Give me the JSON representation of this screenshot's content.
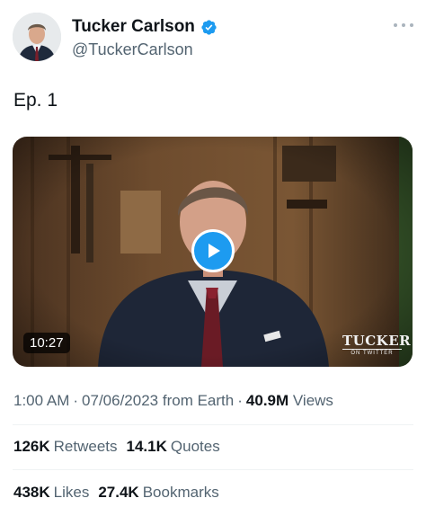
{
  "author": {
    "display_name": "Tucker Carlson",
    "handle": "@TuckerCarlson",
    "verified_icon": "verified-badge-icon",
    "verified_color": "#1d9bf0"
  },
  "tweet": {
    "text": "Ep. 1"
  },
  "video": {
    "duration": "10:27",
    "watermark_main": "TUCKER",
    "watermark_sub": "ON TWITTER",
    "play_icon": "play-icon",
    "accent": "#1d9bf0"
  },
  "meta": {
    "time": "1:00 AM",
    "date": "07/06/2023",
    "source": "from Earth",
    "views_count": "40.9M",
    "views_label": "Views",
    "separator": "·"
  },
  "stats": {
    "retweets_count": "126K",
    "retweets_label": "Retweets",
    "quotes_count": "14.1K",
    "quotes_label": "Quotes",
    "likes_count": "438K",
    "likes_label": "Likes",
    "bookmarks_count": "27.4K",
    "bookmarks_label": "Bookmarks"
  }
}
